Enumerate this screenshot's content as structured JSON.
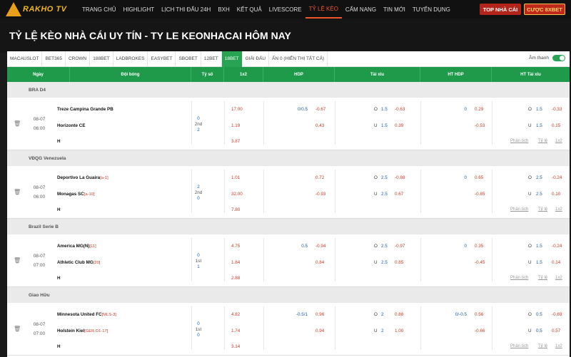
{
  "brand": {
    "logo_text": "RAKHO TV"
  },
  "nav": {
    "items": [
      "TRANG CHỦ",
      "HIGHLIGHT",
      "LỊCH THI ĐẤU 24H",
      "BXH",
      "KẾT QUẢ",
      "LIVESCORE",
      "TỶ LỆ KÈO",
      "CẨM NANG",
      "TIN MỚI",
      "TUYỂN DỤNG"
    ],
    "active_index": 6,
    "btn_top": "TOP NHÀ CÁI",
    "btn_bet": "CƯỢC 8XBET"
  },
  "page": {
    "title": "TỶ LỆ KÈO NHÀ CÁI UY TÍN - TY LE KEONHACAI HÔM NAY"
  },
  "tabs": {
    "items": [
      "MACAUSLOT",
      "BET365",
      "CROWN",
      "188BET",
      "LADBROKES",
      "EASYBET",
      "SBOBET",
      "12BET",
      "18BET",
      "GIẢI ĐẤU",
      "ẨN 0 (HIỂN THỊ TẤT CẢ)"
    ],
    "active_index": 8,
    "sound_label": "Âm thanh"
  },
  "columns": [
    "Ngày",
    "Đội bóng",
    "Tỷ số",
    "1x2",
    "HDP",
    "Tài xỉu",
    "HT HDP",
    "HT Tài xỉu"
  ],
  "links": {
    "analysis": "Phân tích",
    "odds": "Tỷ lệ",
    "onextwo": "1x2"
  },
  "groups": [
    {
      "league": "BRA D4",
      "match": {
        "date": "08-07",
        "time": "06:00",
        "home": "Treze Campina Grande PB",
        "home_tag": "",
        "away": "Horizonte CE",
        "away_tag": "",
        "draw": "H",
        "score_home": "0",
        "period": "2nd",
        "score_away": "2",
        "x12": [
          "17.00",
          "1.19",
          "3.87"
        ],
        "hdp_line": "0/0.5",
        "hdp": [
          "-0.67",
          "0.43"
        ],
        "tx_line": "1.5",
        "tx": [
          "-0.63",
          "0.39"
        ],
        "tx_o": "O",
        "tx_u": "U",
        "hthdp_line": "0",
        "hthdp": [
          "0.29",
          "-0.53"
        ],
        "httx_line": "1.5",
        "httx": [
          "-0.33",
          "0.15"
        ]
      }
    },
    {
      "league": "VĐQG Venezuela",
      "match": {
        "date": "08-07",
        "time": "06:00",
        "home": "Deportivo La Guaira",
        "home_tag": "[a-1]",
        "away": "Monagas SC",
        "away_tag": "[a-10]",
        "draw": "H",
        "score_home": "2",
        "period": "2nd",
        "score_away": "0",
        "x12": [
          "1.01",
          "32.00",
          "7.80"
        ],
        "hdp_line": "",
        "hdp": [
          "0.72",
          "-0.93"
        ],
        "tx_line": "2.5",
        "tx": [
          "-0.88",
          "0.67"
        ],
        "tx_o": "O",
        "tx_u": "U",
        "hthdp_line": "0",
        "hthdp": [
          "0.65",
          "-0.85"
        ],
        "httx_line": "2.5",
        "httx": [
          "-0.24",
          "0.10"
        ]
      }
    },
    {
      "league": "Brazil Serie B",
      "match": {
        "date": "08-07",
        "time": "07:00",
        "home": "America MG(N)",
        "home_tag": "[11]",
        "away": "Athletic Club MG",
        "away_tag": "[20]",
        "draw": "H",
        "score_home": "0",
        "period": "1st",
        "score_away": "1",
        "x12": [
          "4.75",
          "1.84",
          "2.88"
        ],
        "hdp_line": "0.5",
        "hdp": [
          "-0.94",
          "0.84"
        ],
        "tx_line": "2.5",
        "tx": [
          "-0.97",
          "0.85"
        ],
        "tx_o": "O",
        "tx_u": "U",
        "hthdp_line": "0",
        "hthdp": [
          "0.35",
          "-0.45"
        ],
        "httx_line": "1.5",
        "httx": [
          "-0.24",
          "0.14"
        ]
      }
    },
    {
      "league": "Giao Hữu",
      "match": {
        "date": "08-07",
        "time": "07:00",
        "home": "Minnesota United FC",
        "home_tag": "[MLS-3]",
        "away": "Holstein Kiel",
        "away_tag": "[GER D1-17]",
        "draw": "H",
        "score_home": "0",
        "period": "1st",
        "score_away": "0",
        "x12": [
          "4.82",
          "1.74",
          "3.14"
        ],
        "hdp_line": "-0.5/1",
        "hdp": [
          "0.96",
          "0.94"
        ],
        "tx_line": "2",
        "tx": [
          "0.88",
          "1.00"
        ],
        "tx_o": "O",
        "tx_u": "U",
        "hthdp_line": "0/-0.5",
        "hthdp": [
          "0.56",
          "-0.66"
        ],
        "httx_line": "0.5",
        "httx": [
          "-0.69",
          "0.57"
        ]
      }
    }
  ],
  "colors": {
    "accent": "#f0542b",
    "header_green": "#1f9a4b",
    "odds_red": "#d0392b",
    "odds_blue": "#1a5ea8"
  }
}
